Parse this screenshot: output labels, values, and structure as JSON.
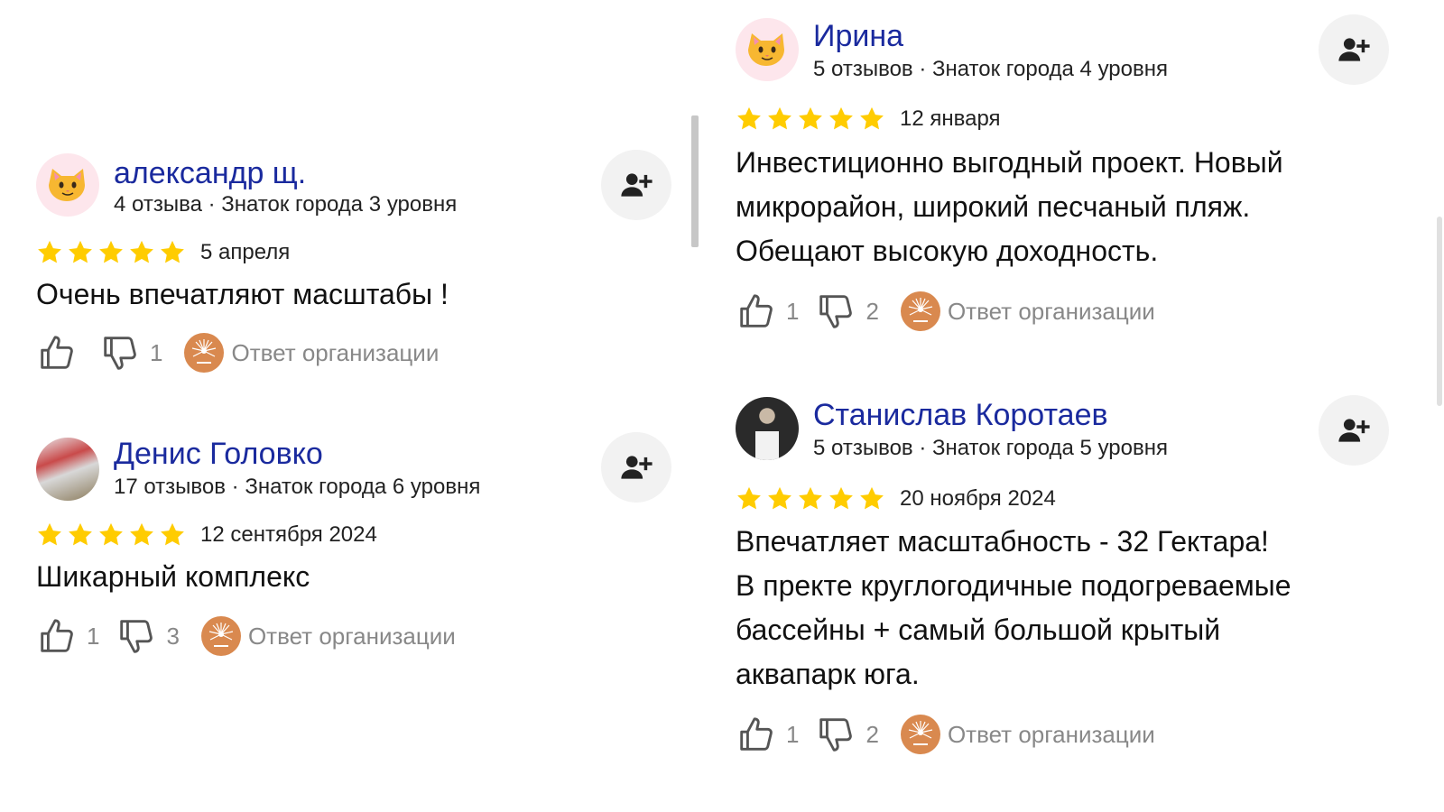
{
  "colors": {
    "author": "#1a2a9e",
    "star": "#ffcc00",
    "muted": "#888888",
    "org_logo": "#d9894f"
  },
  "reviews": [
    {
      "author": "александр щ.",
      "meta": "4 отзыва · Знаток города 3 уровня",
      "avatar": "cat-emoji",
      "rating": 5,
      "date": "5 апреля",
      "text_lines": [
        "Очень впечатляют масштабы !"
      ],
      "likes": "",
      "dislikes": "1",
      "org_reply": "Ответ организации"
    },
    {
      "author": "Денис Головко",
      "meta": "17 отзывов · Знаток города 6 уровня",
      "avatar": "photo",
      "rating": 5,
      "date": "12 сентября 2024",
      "text_lines": [
        "Шикарный комплекс"
      ],
      "likes": "1",
      "dislikes": "3",
      "org_reply": "Ответ организации"
    },
    {
      "author": "Ирина",
      "meta": "5 отзывов · Знаток города 4 уровня",
      "avatar": "cat-emoji",
      "rating": 5,
      "date": "12 января",
      "text_lines": [
        "Инвестиционно выгодный проект. Новый",
        "микрорайон, широкий песчаный пляж.",
        "Обещают высокую доходность."
      ],
      "likes": "1",
      "dislikes": "2",
      "org_reply": "Ответ организации"
    },
    {
      "author": "Станислав Коротаев",
      "meta": "5 отзывов · Знаток города 5 уровня",
      "avatar": "photo",
      "rating": 5,
      "date": "20 ноября 2024",
      "text_lines": [
        "Впечатляет масштабность - 32 Гектара!",
        "В пректе круглогодичные подогреваемые",
        "бассейны + самый большой крытый",
        "аквапарк юга."
      ],
      "likes": "1",
      "dislikes": "2",
      "org_reply": "Ответ организации"
    }
  ],
  "icons": {
    "subscribe": "add-user-icon",
    "like": "thumbs-up-icon",
    "dislike": "thumbs-down-icon",
    "star": "star-icon",
    "org": "org-logo-icon"
  }
}
